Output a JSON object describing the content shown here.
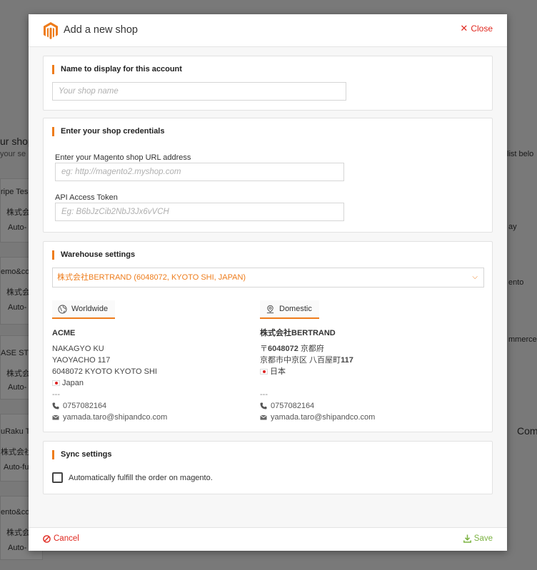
{
  "background": {
    "title": "ur shop",
    "subtitle": "your se",
    "right_hint": "list belo",
    "cards": [
      {
        "name": "ripe Tes",
        "company": "株式会",
        "status": "Auto-"
      },
      {
        "name": "emo&co",
        "company": "株式会",
        "status": "Auto-"
      },
      {
        "name": "ASE STO",
        "company": "株式会",
        "status": "Auto-"
      },
      {
        "name": "uRaku T",
        "company": "株式会社",
        "status": "Auto-fu"
      },
      {
        "name": "ento&co",
        "company": "株式会社",
        "status": "Auto-"
      }
    ],
    "right_labels": [
      "ay",
      "ento",
      "mmerce",
      "Com"
    ]
  },
  "modal": {
    "title": "Add a new shop",
    "close_label": "Close",
    "display_name": {
      "section_title": "Name to display for this account",
      "placeholder": "Your shop name"
    },
    "credentials": {
      "section_title": "Enter your shop credentials",
      "url_label": "Enter your Magento shop URL address",
      "url_placeholder": "eg: http://magento2.myshop.com",
      "token_label": "API Access Token",
      "token_placeholder": "Eg: B6bJzCib2NbJ3Jx6vVCH"
    },
    "warehouse": {
      "section_title": "Warehouse settings",
      "selected": "株式会社BERTRAND (6048072, KYOTO SHI, JAPAN)",
      "worldwide": {
        "tab": "Worldwide",
        "company": "ACME",
        "line1": "NAKAGYO KU",
        "line2": "YAOYACHO 117",
        "line3": "6048072 KYOTO KYOTO SHI",
        "country": "Japan",
        "sep": "---",
        "phone": "0757082164",
        "email": "yamada.taro@shipandco.com"
      },
      "domestic": {
        "tab": "Domestic",
        "company": "株式会社BERTRAND",
        "postal_prefix": "〒",
        "postal": "6048072",
        "prefecture": "京都府",
        "line2a": "京都市中京区 八百屋町",
        "line2b": "117",
        "country": "日本",
        "sep": "---",
        "phone": "0757082164",
        "email": "yamada.taro@shipandco.com"
      }
    },
    "sync": {
      "section_title": "Sync settings",
      "auto_fulfill_label": "Automatically fulfill the order on magento."
    },
    "footer": {
      "cancel_label": "Cancel",
      "save_label": "Save"
    }
  },
  "colors": {
    "accent": "#ee7c1b",
    "danger": "#e0281f",
    "success": "#7cb342"
  }
}
